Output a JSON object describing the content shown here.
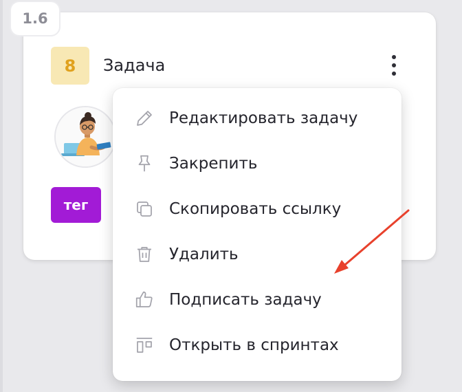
{
  "card": {
    "version": "1.6",
    "points": "8",
    "title": "Задача",
    "tag": "тег"
  },
  "context_menu": {
    "items": [
      {
        "label": "Редактировать задачу",
        "icon": "pencil-icon"
      },
      {
        "label": "Закрепить",
        "icon": "pin-icon"
      },
      {
        "label": "Скопировать ссылку",
        "icon": "copy-icon"
      },
      {
        "label": "Удалить",
        "icon": "trash-icon"
      },
      {
        "label": "Подписать задачу",
        "icon": "thumbs-up-icon"
      },
      {
        "label": "Открыть в спринтах",
        "icon": "sprint-board-icon"
      }
    ]
  },
  "colors": {
    "points_bg": "#f8e8b4",
    "points_text": "#e0a11d",
    "tag_bg": "#a21bd6",
    "arrow": "#e8412c"
  }
}
